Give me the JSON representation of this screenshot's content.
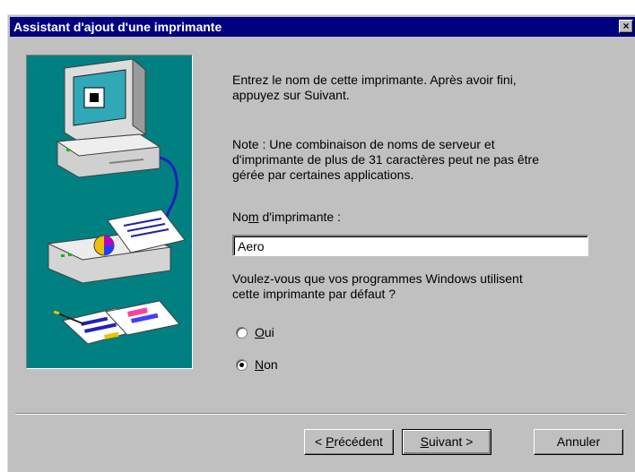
{
  "window": {
    "title": "Assistant d'ajout d'une imprimante",
    "close_label": "×"
  },
  "content": {
    "intro_line1": "Entrez le nom de cette imprimante. Après avoir fini,",
    "intro_line2": "appuyez sur Suivant.",
    "note_line1": "Note : Une combinaison de noms de serveur et",
    "note_line2": "d'imprimante de plus de 31 caractères peut ne pas être",
    "note_line3": "gérée par certaines applications.",
    "printer_name_label_pre": "No",
    "printer_name_label_key": "m",
    "printer_name_label_post": " d'imprimante :",
    "printer_name_value": "Aero",
    "default_question_line1": "Voulez-vous que vos programmes Windows utilisent",
    "default_question_line2": "cette imprimante par défaut ?",
    "radio_yes_key": "O",
    "radio_yes_rest": "ui",
    "radio_no_key": "N",
    "radio_no_rest": "on",
    "selected": "Non"
  },
  "buttons": {
    "back_pre": "< ",
    "back_key": "P",
    "back_rest": "récédent",
    "next_key": "S",
    "next_rest": "uivant >",
    "cancel": "Annuler"
  },
  "colors": {
    "titlebar": "#000080",
    "dialog_bg": "#c0c0c0",
    "illustration_bg": "#008080"
  }
}
